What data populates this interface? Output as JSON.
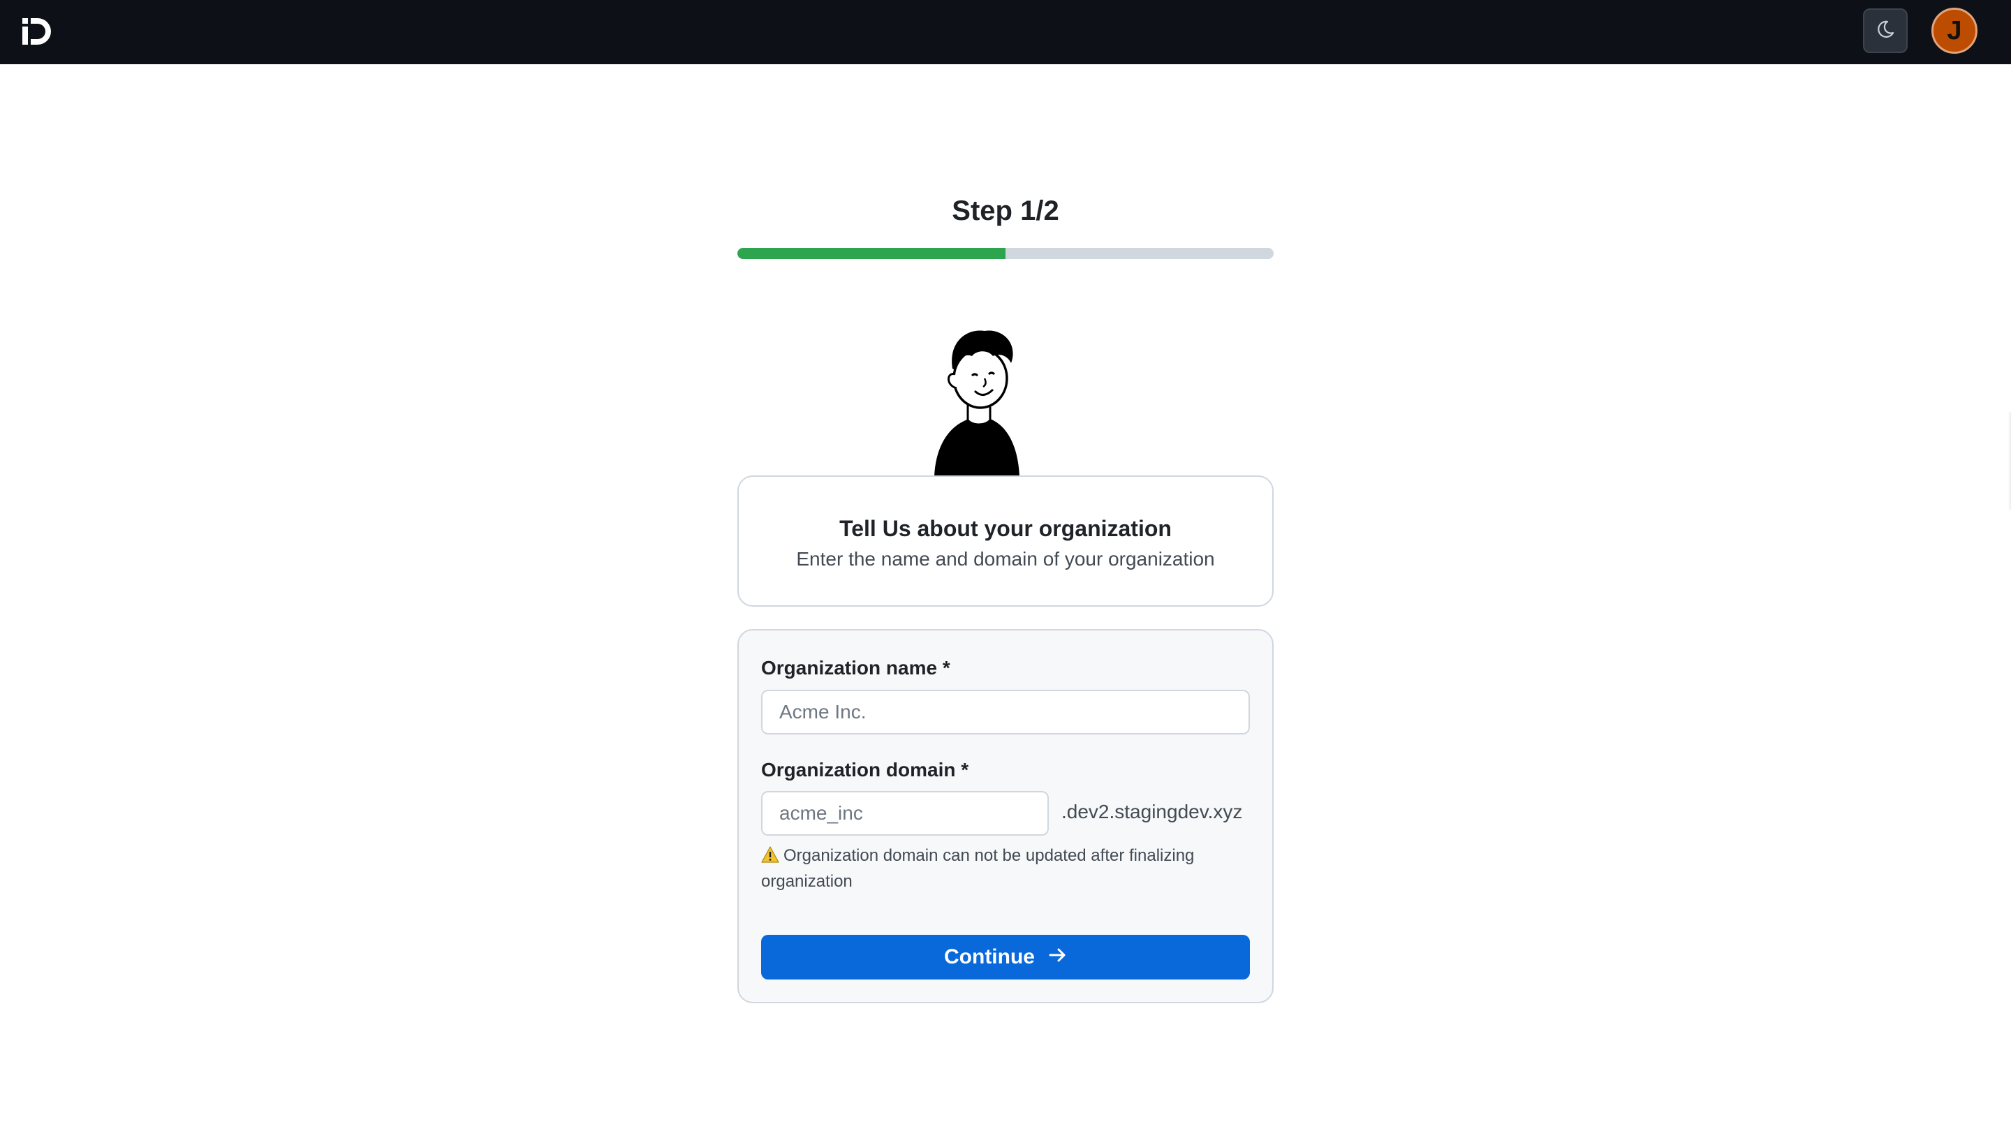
{
  "header": {
    "logo_icon": "brand-logo-icon",
    "theme_toggle_icon": "moon-icon",
    "avatar_initial": "J",
    "avatar_color": "#bc4c00"
  },
  "step": {
    "title": "Step 1/2",
    "progress_fraction": 0.5,
    "progress_color": "#2da44e"
  },
  "intro": {
    "title": "Tell Us about your organization",
    "subtitle": "Enter the name and domain of your organization"
  },
  "form": {
    "org_name_label": "Organization name *",
    "org_name_placeholder": "Acme Inc.",
    "org_name_value": "",
    "org_domain_label": "Organization domain *",
    "org_domain_placeholder": "acme_inc",
    "org_domain_value": "",
    "domain_suffix": ".dev2.stagingdev.xyz",
    "warning_icon": "warning-icon",
    "warning_text": "Organization domain can not be updated after finalizing organization",
    "continue_label": "Continue",
    "continue_icon": "arrow-right-icon",
    "button_color": "#0969da"
  }
}
